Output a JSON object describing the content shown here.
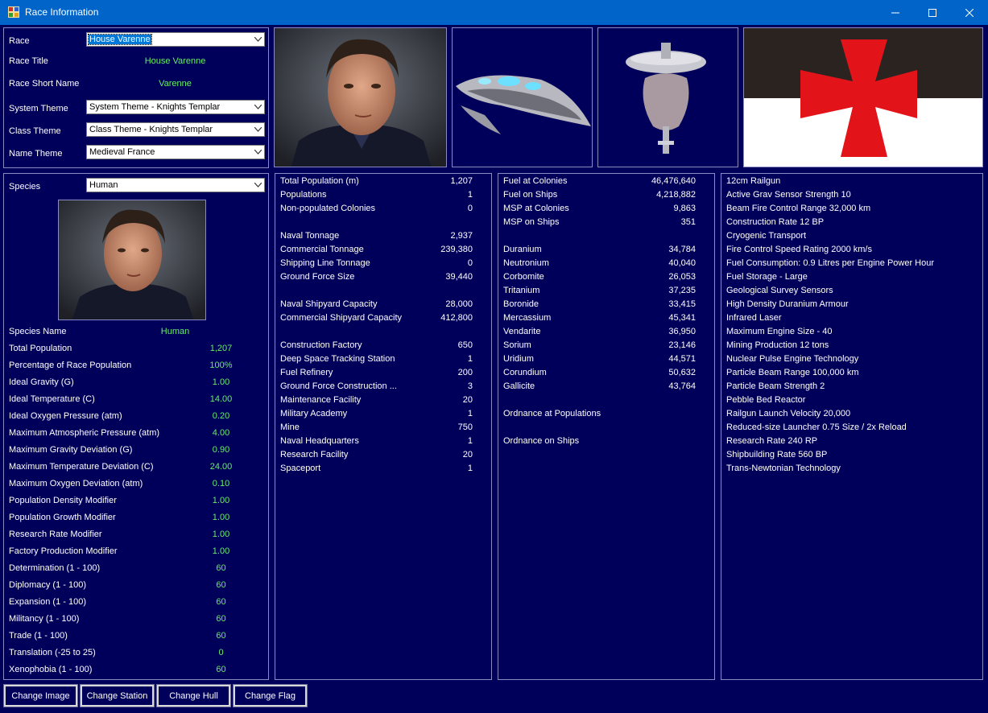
{
  "window": {
    "title": "Race Information"
  },
  "race_panel": {
    "race_label": "Race",
    "race_value": "House Varenne",
    "race_title_label": "Race Title",
    "race_title_value": "House Varenne",
    "race_short_label": "Race Short Name",
    "race_short_value": "Varenne",
    "system_theme_label": "System Theme",
    "system_theme_value": "System Theme - Knights Templar",
    "class_theme_label": "Class Theme",
    "class_theme_value": "Class Theme - Knights Templar",
    "name_theme_label": "Name Theme",
    "name_theme_value": "Medieval France"
  },
  "species_panel": {
    "species_label": "Species",
    "species_value": "Human",
    "species_name_label": "Species Name",
    "species_name_value": "Human",
    "stats": [
      {
        "label": "Total Population",
        "value": "1,207"
      },
      {
        "label": "Percentage of Race Population",
        "value": "100%"
      },
      {
        "label": "Ideal Gravity (G)",
        "value": "1.00"
      },
      {
        "label": "Ideal Temperature (C)",
        "value": "14.00"
      },
      {
        "label": "Ideal Oxygen Pressure (atm)",
        "value": "0.20"
      },
      {
        "label": "Maximum Atmospheric Pressure (atm)",
        "value": "4.00"
      },
      {
        "label": "Maximum Gravity Deviation (G)",
        "value": "0.90"
      },
      {
        "label": "Maximum Temperature Deviation (C)",
        "value": "24.00"
      },
      {
        "label": "Maximum Oxygen Deviation (atm)",
        "value": "0.10"
      },
      {
        "label": "Population Density Modifier",
        "value": "1.00"
      },
      {
        "label": "Population Growth Modifier",
        "value": "1.00"
      },
      {
        "label": "Research Rate Modifier",
        "value": "1.00"
      },
      {
        "label": "Factory Production Modifier",
        "value": "1.00"
      },
      {
        "label": "Determination (1 - 100)",
        "value": "60"
      },
      {
        "label": "Diplomacy (1 - 100)",
        "value": "60"
      },
      {
        "label": "Expansion (1 - 100)",
        "value": "60"
      },
      {
        "label": "Militancy (1 - 100)",
        "value": "60"
      },
      {
        "label": "Trade (1 - 100)",
        "value": "60"
      },
      {
        "label": "Translation (-25 to 25)",
        "value": "0"
      },
      {
        "label": "Xenophobia (1 - 100)",
        "value": "60"
      }
    ]
  },
  "population_list": [
    {
      "label": "Total Population (m)",
      "value": "1,207"
    },
    {
      "label": "Populations",
      "value": "1"
    },
    {
      "label": "Non-populated Colonies",
      "value": "0"
    },
    {
      "label": "",
      "value": ""
    },
    {
      "label": "Naval Tonnage",
      "value": "2,937"
    },
    {
      "label": "Commercial Tonnage",
      "value": "239,380"
    },
    {
      "label": "Shipping Line Tonnage",
      "value": "0"
    },
    {
      "label": "Ground Force Size",
      "value": "39,440"
    },
    {
      "label": "",
      "value": ""
    },
    {
      "label": "Naval Shipyard Capacity",
      "value": "28,000"
    },
    {
      "label": "Commercial Shipyard Capacity",
      "value": "412,800"
    },
    {
      "label": "",
      "value": ""
    },
    {
      "label": "Construction Factory",
      "value": "650"
    },
    {
      "label": "Deep Space Tracking Station",
      "value": "1"
    },
    {
      "label": "Fuel Refinery",
      "value": "200"
    },
    {
      "label": "Ground Force Construction ...",
      "value": "3"
    },
    {
      "label": "Maintenance Facility",
      "value": "20"
    },
    {
      "label": "Military Academy",
      "value": "1"
    },
    {
      "label": "Mine",
      "value": "750"
    },
    {
      "label": "Naval Headquarters",
      "value": "1"
    },
    {
      "label": "Research Facility",
      "value": "20"
    },
    {
      "label": "Spaceport",
      "value": "1"
    }
  ],
  "resource_list": [
    {
      "label": "Fuel at Colonies",
      "value": "46,476,640"
    },
    {
      "label": "Fuel on Ships",
      "value": "4,218,882"
    },
    {
      "label": "MSP at Colonies",
      "value": "9,863"
    },
    {
      "label": "MSP on Ships",
      "value": "351"
    },
    {
      "label": "",
      "value": ""
    },
    {
      "label": "Duranium",
      "value": "34,784"
    },
    {
      "label": "Neutronium",
      "value": "40,040"
    },
    {
      "label": "Corbomite",
      "value": "26,053"
    },
    {
      "label": "Tritanium",
      "value": "37,235"
    },
    {
      "label": "Boronide",
      "value": "33,415"
    },
    {
      "label": "Mercassium",
      "value": "45,341"
    },
    {
      "label": "Vendarite",
      "value": "36,950"
    },
    {
      "label": "Sorium",
      "value": "23,146"
    },
    {
      "label": "Uridium",
      "value": "44,571"
    },
    {
      "label": "Corundium",
      "value": "50,632"
    },
    {
      "label": "Gallicite",
      "value": "43,764"
    },
    {
      "label": "",
      "value": ""
    },
    {
      "label": "Ordnance at Populations",
      "value": ""
    },
    {
      "label": "",
      "value": ""
    },
    {
      "label": "Ordnance on Ships",
      "value": ""
    }
  ],
  "tech_list": [
    "12cm Railgun",
    "Active Grav Sensor Strength 10",
    "Beam Fire Control Range 32,000 km",
    "Construction Rate 12 BP",
    "Cryogenic Transport",
    "Fire Control Speed Rating 2000 km/s",
    "Fuel Consumption: 0.9 Litres per Engine Power Hour",
    "Fuel Storage - Large",
    "Geological Survey Sensors",
    "High Density Duranium Armour",
    "Infrared Laser",
    "Maximum Engine Size - 40",
    "Mining Production 12 tons",
    "Nuclear Pulse Engine Technology",
    "Particle Beam Range 100,000 km",
    "Particle Beam Strength 2",
    "Pebble Bed Reactor",
    "Railgun Launch Velocity 20,000",
    "Reduced-size Launcher 0.75 Size / 2x Reload",
    "Research Rate 240 RP",
    "Shipbuilding Rate 560 BP",
    "Trans-Newtonian Technology"
  ],
  "buttons": {
    "change_image": "Change Image",
    "change_station": "Change Station",
    "change_hull": "Change Hull",
    "change_flag": "Change Flag"
  },
  "icons": {
    "app": "app-window-icon",
    "minimize": "minimize-icon",
    "maximize": "maximize-icon",
    "close": "close-icon",
    "dropdown": "chevron-down-icon"
  },
  "colors": {
    "background": "#00005a",
    "titlebar": "#0064c8",
    "value_green": "#66ee66",
    "border": "#8a8ac4",
    "flag_black": "#2b2320",
    "flag_red": "#e2141a"
  }
}
